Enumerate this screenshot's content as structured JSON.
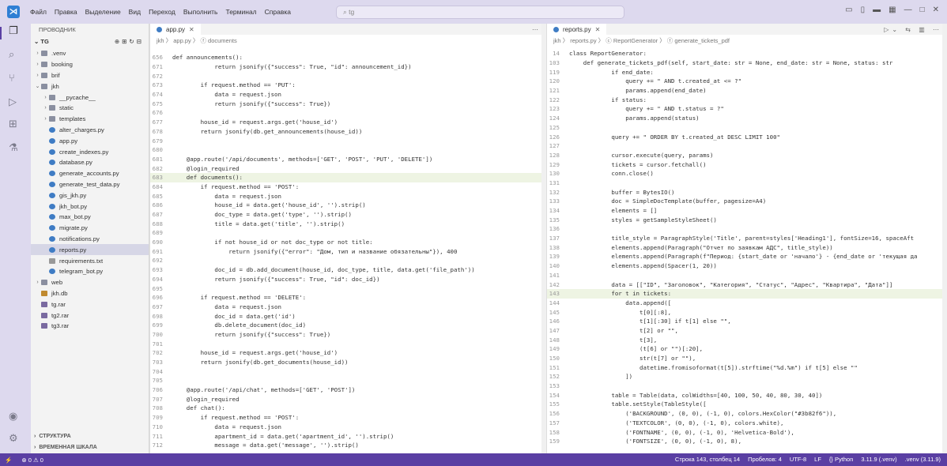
{
  "menu": [
    "Файл",
    "Правка",
    "Выделение",
    "Вид",
    "Переход",
    "Выполнить",
    "Терминал",
    "Справка"
  ],
  "search": {
    "value": "tg"
  },
  "sidebar": {
    "header": "ПРОВОДНИК",
    "root": "TG",
    "items": [
      {
        "label": ".venv",
        "type": "folder",
        "indent": 1,
        "chev": "›"
      },
      {
        "label": "booking",
        "type": "folder",
        "indent": 1,
        "chev": "›"
      },
      {
        "label": "brif",
        "type": "folder",
        "indent": 1,
        "chev": "›"
      },
      {
        "label": "jkh",
        "type": "folder",
        "indent": 1,
        "chev": "⌄"
      },
      {
        "label": "__pycache__",
        "type": "folder",
        "indent": 2,
        "chev": "›"
      },
      {
        "label": "static",
        "type": "folder",
        "indent": 2,
        "chev": "›"
      },
      {
        "label": "templates",
        "type": "folder",
        "indent": 2,
        "chev": "›"
      },
      {
        "label": "alter_charges.py",
        "type": "py",
        "indent": 2
      },
      {
        "label": "app.py",
        "type": "py",
        "indent": 2
      },
      {
        "label": "create_indexes.py",
        "type": "py",
        "indent": 2
      },
      {
        "label": "database.py",
        "type": "py",
        "indent": 2
      },
      {
        "label": "generate_accounts.py",
        "type": "py",
        "indent": 2
      },
      {
        "label": "generate_test_data.py",
        "type": "py",
        "indent": 2
      },
      {
        "label": "gis_jkh.py",
        "type": "py",
        "indent": 2
      },
      {
        "label": "jkh_bot.py",
        "type": "py",
        "indent": 2
      },
      {
        "label": "max_bot.py",
        "type": "py",
        "indent": 2
      },
      {
        "label": "migrate.py",
        "type": "py",
        "indent": 2
      },
      {
        "label": "notifications.py",
        "type": "py",
        "indent": 2
      },
      {
        "label": "reports.py",
        "type": "py",
        "indent": 2,
        "selected": true
      },
      {
        "label": "requirements.txt",
        "type": "txt",
        "indent": 2
      },
      {
        "label": "telegram_bot.py",
        "type": "py",
        "indent": 2
      },
      {
        "label": "web",
        "type": "folder",
        "indent": 1,
        "chev": "›"
      },
      {
        "label": "jkh.db",
        "type": "db",
        "indent": 1
      },
      {
        "label": "tg.rar",
        "type": "rar",
        "indent": 1
      },
      {
        "label": "tg2.rar",
        "type": "rar",
        "indent": 1
      },
      {
        "label": "tg3.rar",
        "type": "rar",
        "indent": 1
      }
    ],
    "footer": [
      "СТРУКТУРА",
      "ВРЕМЕННАЯ ШКАЛА"
    ]
  },
  "left_editor": {
    "tab": "app.py",
    "breadcrumb": "jkh 〉 app.py 〉 ⓕ documents",
    "lines": [
      [
        "656",
        "def announcements():"
      ],
      [
        "671",
        "            return jsonify({\"success\": True, \"id\": announcement_id})"
      ],
      [
        "672",
        ""
      ],
      [
        "673",
        "        if request.method == 'PUT':"
      ],
      [
        "674",
        "            data = request.json"
      ],
      [
        "675",
        "            return jsonify({\"success\": True})"
      ],
      [
        "676",
        ""
      ],
      [
        "677",
        "        house_id = request.args.get('house_id')"
      ],
      [
        "678",
        "        return jsonify(db.get_announcements(house_id))"
      ],
      [
        "679",
        ""
      ],
      [
        "680",
        ""
      ],
      [
        "681",
        "    @app.route('/api/documents', methods=['GET', 'POST', 'PUT', 'DELETE'])"
      ],
      [
        "682",
        "    @login_required"
      ],
      [
        "683",
        "    def documents():"
      ],
      [
        "684",
        "        if request.method == 'POST':"
      ],
      [
        "685",
        "            data = request.json"
      ],
      [
        "686",
        "            house_id = data.get('house_id', '').strip()"
      ],
      [
        "687",
        "            doc_type = data.get('type', '').strip()"
      ],
      [
        "688",
        "            title = data.get('title', '').strip()"
      ],
      [
        "689",
        ""
      ],
      [
        "690",
        "            if not house_id or not doc_type or not title:"
      ],
      [
        "691",
        "                return jsonify({\"error\": \"Дом, тип и название обязательны\"}), 400"
      ],
      [
        "692",
        ""
      ],
      [
        "693",
        "            doc_id = db.add_document(house_id, doc_type, title, data.get('file_path'))"
      ],
      [
        "694",
        "            return jsonify({\"success\": True, \"id\": doc_id})"
      ],
      [
        "695",
        ""
      ],
      [
        "696",
        "        if request.method == 'DELETE':"
      ],
      [
        "697",
        "            data = request.json"
      ],
      [
        "698",
        "            doc_id = data.get('id')"
      ],
      [
        "699",
        "            db.delete_document(doc_id)"
      ],
      [
        "700",
        "            return jsonify({\"success\": True})"
      ],
      [
        "701",
        ""
      ],
      [
        "702",
        "        house_id = request.args.get('house_id')"
      ],
      [
        "703",
        "        return jsonify(db.get_documents(house_id))"
      ],
      [
        "704",
        ""
      ],
      [
        "705",
        ""
      ],
      [
        "706",
        "    @app.route('/api/chat', methods=['GET', 'POST'])"
      ],
      [
        "707",
        "    @login_required"
      ],
      [
        "708",
        "    def chat():"
      ],
      [
        "709",
        "        if request.method == 'POST':"
      ],
      [
        "710",
        "            data = request.json"
      ],
      [
        "711",
        "            apartment_id = data.get('apartment_id', '').strip()"
      ],
      [
        "712",
        "            message = data.get('message', '').strip()"
      ]
    ]
  },
  "right_editor": {
    "tab": "reports.py",
    "breadcrumb": "jkh 〉 reports.py 〉 ⓒ ReportGenerator 〉 ⓕ generate_tickets_pdf",
    "lines": [
      [
        "14",
        "class ReportGenerator:"
      ],
      [
        "103",
        "    def generate_tickets_pdf(self, start_date: str = None, end_date: str = None, status: str"
      ],
      [
        "119",
        "            if end_date:"
      ],
      [
        "120",
        "                query += \" AND t.created_at <= ?\""
      ],
      [
        "121",
        "                params.append(end_date)"
      ],
      [
        "122",
        "            if status:"
      ],
      [
        "123",
        "                query += \" AND t.status = ?\""
      ],
      [
        "124",
        "                params.append(status)"
      ],
      [
        "125",
        ""
      ],
      [
        "126",
        "            query += \" ORDER BY t.created_at DESC LIMIT 100\""
      ],
      [
        "127",
        ""
      ],
      [
        "128",
        "            cursor.execute(query, params)"
      ],
      [
        "129",
        "            tickets = cursor.fetchall()"
      ],
      [
        "130",
        "            conn.close()"
      ],
      [
        "131",
        ""
      ],
      [
        "132",
        "            buffer = BytesIO()"
      ],
      [
        "133",
        "            doc = SimpleDocTemplate(buffer, pagesize=A4)"
      ],
      [
        "134",
        "            elements = []"
      ],
      [
        "135",
        "            styles = getSampleStyleSheet()"
      ],
      [
        "136",
        ""
      ],
      [
        "137",
        "            title_style = ParagraphStyle('Title', parent=styles['Heading1'], fontSize=16, spaceAft"
      ],
      [
        "138",
        "            elements.append(Paragraph(\"Отчет по заявкам АДС\", title_style))"
      ],
      [
        "139",
        "            elements.append(Paragraph(f\"Период: {start_date or 'начало'} - {end_date or 'текущая да"
      ],
      [
        "140",
        "            elements.append(Spacer(1, 20))"
      ],
      [
        "141",
        ""
      ],
      [
        "142",
        "            data = [[\"ID\", \"Заголовок\", \"Категория\", \"Статус\", \"Адрес\", \"Квартира\", \"Дата\"]]"
      ],
      [
        "143",
        "            for t in tickets:"
      ],
      [
        "144",
        "                data.append(["
      ],
      [
        "145",
        "                    t[0][:8],"
      ],
      [
        "146",
        "                    t[1][:30] if t[1] else \"\","
      ],
      [
        "147",
        "                    t[2] or \"\","
      ],
      [
        "148",
        "                    t[3],"
      ],
      [
        "149",
        "                    (t[6] or \"\")[:20],"
      ],
      [
        "150",
        "                    str(t[7] or \"\"),"
      ],
      [
        "151",
        "                    datetime.fromisoformat(t[5]).strftime(\"%d.%m\") if t[5] else \"\""
      ],
      [
        "152",
        "                ])"
      ],
      [
        "153",
        ""
      ],
      [
        "154",
        "            table = Table(data, colWidths=[40, 100, 50, 40, 80, 30, 40])"
      ],
      [
        "155",
        "            table.setStyle(TableStyle(["
      ],
      [
        "156",
        "                ('BACKGROUND', (0, 0), (-1, 0), colors.HexColor(\"#3b82f6\")),"
      ],
      [
        "157",
        "                ('TEXTCOLOR', (0, 0), (-1, 0), colors.white),"
      ],
      [
        "158",
        "                ('FONTNAME', (0, 0), (-1, 0), 'Helvetica-Bold'),"
      ],
      [
        "159",
        "                ('FONTSIZE', (0, 0), (-1, 0), 8),"
      ]
    ]
  },
  "status": {
    "left": "⊗ 0 ⚠ 0",
    "right": [
      "Строка 143, столбец 14",
      "Пробелов: 4",
      "UTF-8",
      "LF",
      "{} Python",
      "3.11.9 (.venv)",
      ".venv (3.11.9)"
    ]
  },
  "colors": {
    "accent": "#5a3fa3",
    "titlebar": "#ddd9ee"
  }
}
